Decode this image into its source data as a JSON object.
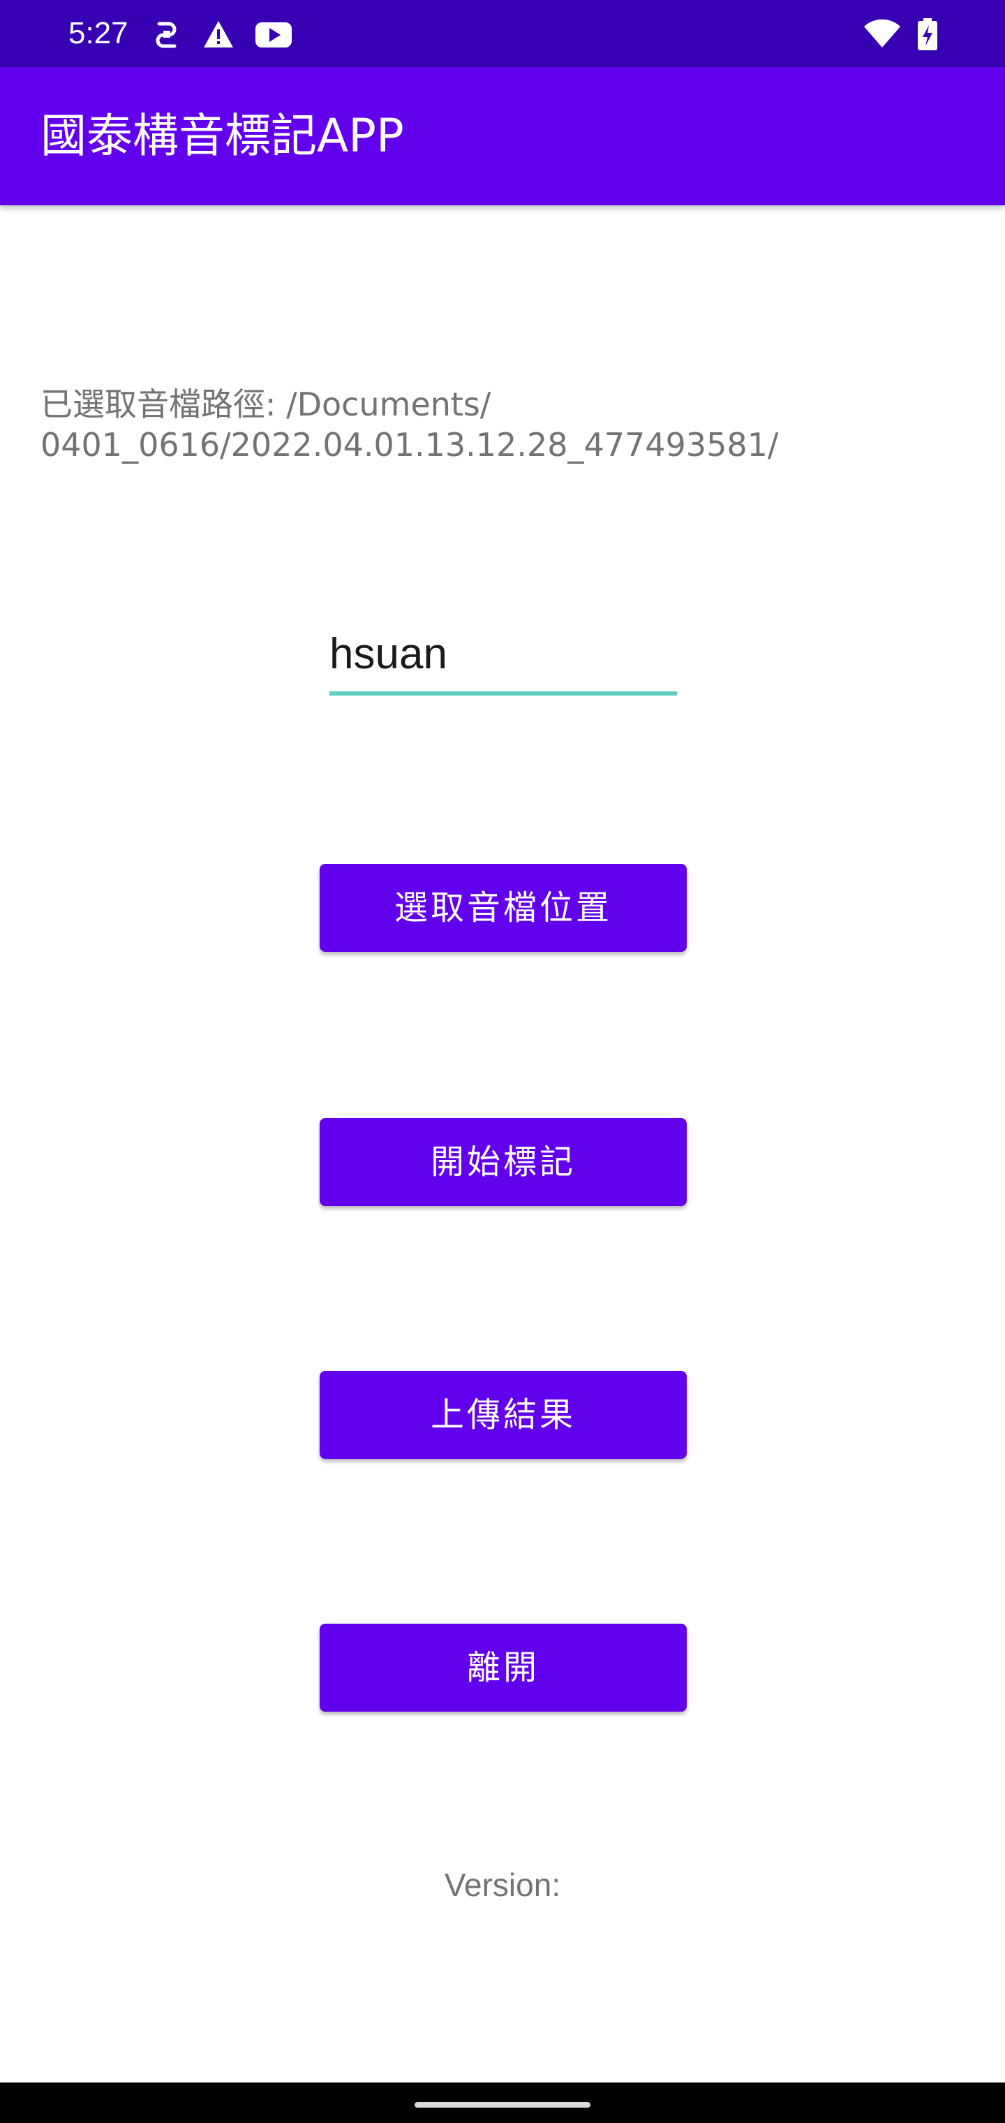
{
  "status_bar": {
    "time": "5:27",
    "icons_left": [
      "data-saver-icon",
      "warning-icon",
      "youtube-icon"
    ],
    "icons_right": [
      "wifi-icon",
      "battery-charging-icon"
    ],
    "background": "#3700b3"
  },
  "app_bar": {
    "title": "國泰構音標記APP",
    "background": "#6200ee"
  },
  "path": {
    "line1": "已選取音檔路徑: /Documents/",
    "line2": "0401_0616/2022.04.01.13.12.28_477493581/"
  },
  "name_input": {
    "value": "hsuan",
    "accent": "#5fcfc0"
  },
  "buttons": {
    "select_audio": "選取音檔位置",
    "start_marking": "開始標記",
    "upload_results": "上傳結果",
    "leave": "離開",
    "color": "#6200ee"
  },
  "footer": {
    "version": "Version:"
  }
}
